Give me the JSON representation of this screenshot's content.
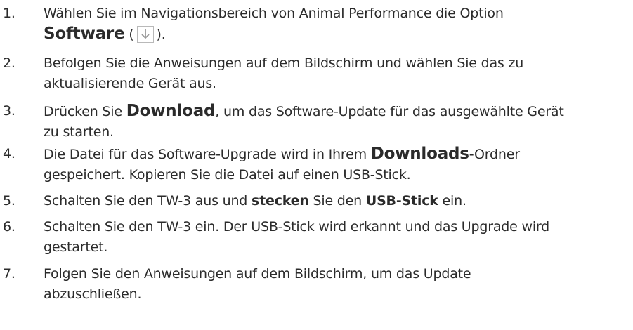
{
  "steps": [
    {
      "number": "1.",
      "line1": "Wählen Sie im Navigationsbereich von Animal Performance die Option",
      "bold": "Software",
      "paren_open": " (",
      "paren_close": ").",
      "icon": "download-arrow-icon"
    },
    {
      "number": "2.",
      "line1": "Befolgen Sie die Anweisungen auf dem Bildschirm und wählen Sie das zu",
      "line2": "aktualisierende Gerät aus."
    },
    {
      "number": "3.",
      "pre": "Drücken Sie ",
      "bold": "Download",
      "post": ", um das Software-Update für das ausgewählte Gerät",
      "line2": "zu starten."
    },
    {
      "number": "4.",
      "pre": "Die Datei für das Software-Upgrade wird in Ihrem ",
      "bold": "Downloads",
      "post": "-Ordner",
      "line2": "gespeichert. Kopieren Sie die Datei auf einen USB-Stick."
    },
    {
      "number": "5.",
      "t1": "Schalten Sie den TW-3 aus und ",
      "b1": "stecken",
      "t2": " Sie den ",
      "b2": "USB-Stick",
      "t3": " ein."
    },
    {
      "number": "6.",
      "line1": "Schalten Sie den TW-3 ein. Der USB-Stick wird erkannt und das Upgrade wird",
      "line2": "gestartet."
    },
    {
      "number": "7.",
      "line1": "Folgen Sie den Anweisungen auf dem Bildschirm, um das Update",
      "line2": "abzuschließen."
    }
  ]
}
